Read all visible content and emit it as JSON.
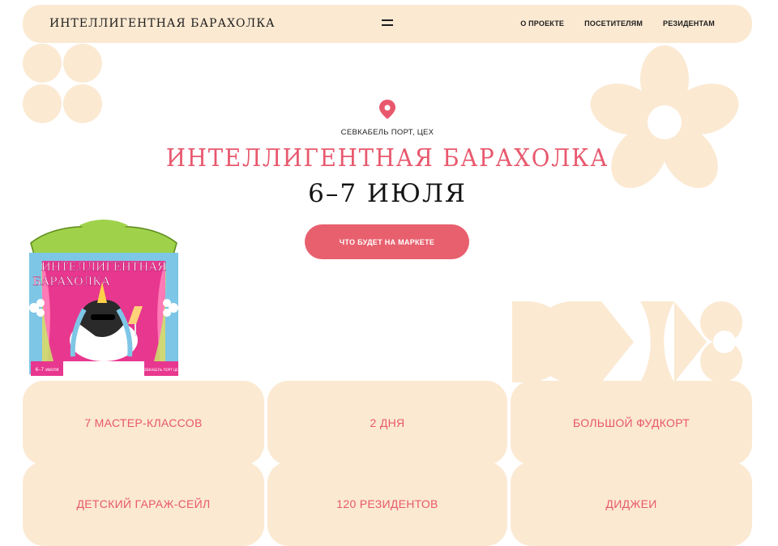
{
  "header": {
    "logo": "ИНТЕЛЛИГЕНТНАЯ БАРАХОЛКА",
    "nav": [
      "О ПРОЕКТЕ",
      "ПОСЕТИТЕЛЯМ",
      "РЕЗИДЕНТАМ"
    ]
  },
  "hero": {
    "location": "СЕВКАБЕЛЬ ПОРТ, ЦЕХ",
    "title": "ИНТЕЛЛИГЕНТНАЯ БАРАХОЛКА",
    "date": "6–7 ИЮЛЯ",
    "cta": "ЧТО БУДЕТ НА МАРКЕТЕ"
  },
  "poster": {
    "title_line1": "ИНТЕЛЛИГЕНТНАЯ",
    "title_line2": "БАРАХОЛКА",
    "date": "6–7 июля",
    "place": "СЕВКАБЕЛЬ ПОРТ ЦЕХ"
  },
  "features": [
    "7 МАСТЕР-КЛАССОВ",
    "2 ДНЯ",
    "БОЛЬШОЙ ФУДКОРТ",
    "ДЕТСКИЙ ГАРАЖ-СЕЙЛ",
    "120 РЕЗИДЕНТОВ",
    "ДИДЖЕИ"
  ],
  "colors": {
    "accent": "#e8586d",
    "cream": "#fbe9d2",
    "text": "#1e1e1e"
  },
  "icons": [
    "menu-icon",
    "location-pin-icon"
  ]
}
